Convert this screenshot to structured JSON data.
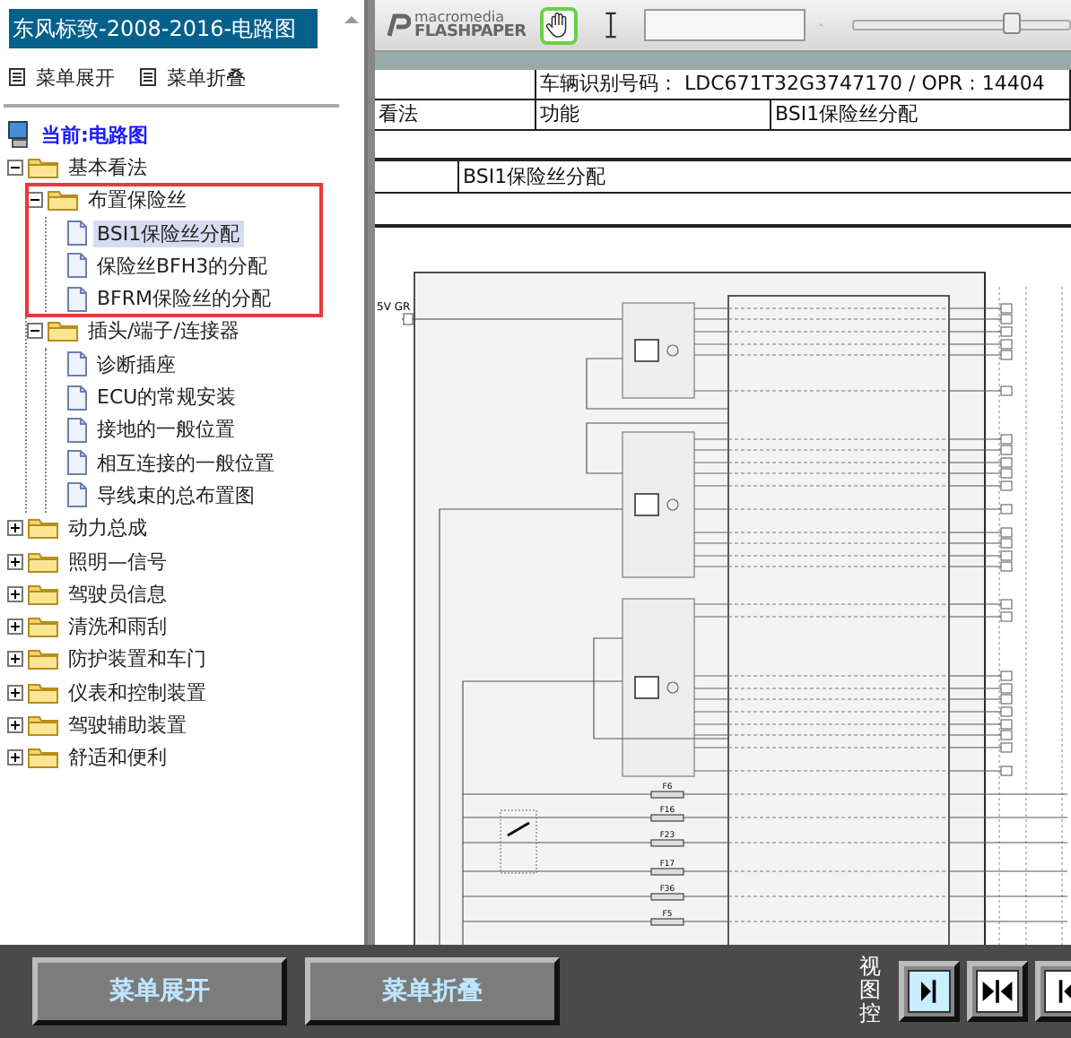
{
  "app_title": "东风标致-2008-2016-电路图",
  "menu_links": [
    "菜单展开",
    "菜单折叠"
  ],
  "tree": [
    {
      "label": "当前:电路图",
      "kind": "current"
    },
    {
      "label": "基本看法",
      "kind": "folder",
      "expanded": true,
      "framed": false,
      "children": [
        {
          "label": "布置保险丝",
          "kind": "folder",
          "expanded": true,
          "framed": true,
          "children": [
            {
              "label": "BSI1保险丝分配",
              "kind": "page",
              "selected": true
            },
            {
              "label": "保险丝BFH3的分配",
              "kind": "page",
              "selected": false
            },
            {
              "label": "BFRM保险丝的分配",
              "kind": "page",
              "selected": false
            }
          ]
        },
        {
          "label": "插头/端子/连接器",
          "kind": "folder",
          "expanded": true,
          "framed": false,
          "children": [
            {
              "label": "诊断插座",
              "kind": "page",
              "selected": false
            },
            {
              "label": "ECU的常规安装",
              "kind": "page",
              "selected": false
            },
            {
              "label": "接地的一般位置",
              "kind": "page",
              "selected": false
            },
            {
              "label": "相互连接的一般位置",
              "kind": "page",
              "selected": false
            },
            {
              "label": "导线束的总布置图",
              "kind": "page",
              "selected": false
            }
          ]
        }
      ]
    },
    {
      "label": "动力总成",
      "kind": "folder",
      "expanded": false,
      "framed": false
    },
    {
      "label": "照明—信号",
      "kind": "folder",
      "expanded": false,
      "framed": false
    },
    {
      "label": "驾驶员信息",
      "kind": "folder",
      "expanded": false,
      "framed": false
    },
    {
      "label": "清洗和雨刮",
      "kind": "folder",
      "expanded": false,
      "framed": false
    },
    {
      "label": "防护装置和车门",
      "kind": "folder",
      "expanded": false,
      "framed": false
    },
    {
      "label": "仪表和控制装置",
      "kind": "folder",
      "expanded": false,
      "framed": false
    },
    {
      "label": "驾驶辅助装置",
      "kind": "folder",
      "expanded": false,
      "framed": false
    },
    {
      "label": "舒适和便利",
      "kind": "folder",
      "expanded": false,
      "framed": false
    }
  ],
  "viewer": {
    "logo_top": "macromedia",
    "logo_bottom": "FLASHPAPER",
    "tools": [
      {
        "kind": "hand",
        "selected": true
      },
      {
        "kind": "text",
        "selected": false
      }
    ],
    "zoom": {
      "level": 0.73
    }
  },
  "document": {
    "vin": "车辆识别号码：  LDC671T32G3747170 / OPR : 14404",
    "info_cells": [
      "看法",
      "功能",
      "BSI1保险丝分配"
    ],
    "section_title": "BSI1保险丝分配",
    "diagram_labels": [
      "5V GR",
      "F6",
      "F16",
      "F23",
      "F17",
      "F36",
      "F5"
    ]
  },
  "bottom": {
    "buttons": [
      "菜单展开",
      "菜单折叠"
    ],
    "view_label": "视图控",
    "view_buttons": [
      {
        "kind": "expand-right",
        "selected": true
      },
      {
        "kind": "center",
        "selected": false
      },
      {
        "kind": "expand-left",
        "selected": false
      }
    ]
  }
}
